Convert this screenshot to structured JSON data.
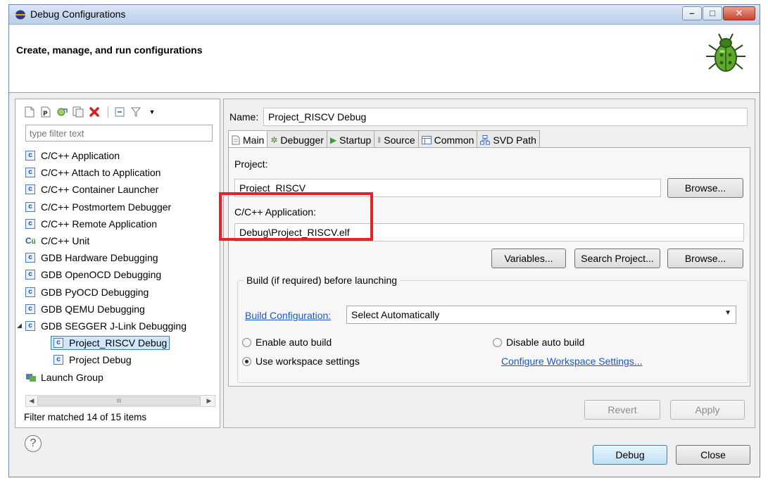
{
  "window": {
    "title": "Debug Configurations",
    "minimize": "–",
    "maximize": "□",
    "close": "✕"
  },
  "banner": {
    "title": "Create, manage, and run configurations"
  },
  "left": {
    "filter_placeholder": "type filter text",
    "tree": [
      {
        "label": "C/C++ Application",
        "icon": "c"
      },
      {
        "label": "C/C++ Attach to Application",
        "icon": "c"
      },
      {
        "label": "C/C++ Container Launcher",
        "icon": "c"
      },
      {
        "label": "C/C++ Postmortem Debugger",
        "icon": "c"
      },
      {
        "label": "C/C++ Remote Application",
        "icon": "c"
      },
      {
        "label": "C/C++ Unit",
        "icon": "cu"
      },
      {
        "label": "GDB Hardware Debugging",
        "icon": "c"
      },
      {
        "label": "GDB OpenOCD Debugging",
        "icon": "c"
      },
      {
        "label": "GDB PyOCD Debugging",
        "icon": "c"
      },
      {
        "label": "GDB QEMU Debugging",
        "icon": "c"
      },
      {
        "label": "GDB SEGGER J-Link Debugging",
        "icon": "c"
      },
      {
        "label": "Project_RISCV Debug",
        "icon": "c"
      },
      {
        "label": "Project Debug",
        "icon": "c"
      },
      {
        "label": "Launch Group",
        "icon": "launch-group"
      }
    ],
    "status": "Filter matched 14 of 15 items"
  },
  "right": {
    "name_label": "Name:",
    "name_value": "Project_RISCV Debug",
    "tabs": [
      {
        "label": "Main",
        "icon": "main-tab-icon"
      },
      {
        "label": "Debugger",
        "icon": "debugger-tab-icon"
      },
      {
        "label": "Startup",
        "icon": "startup-tab-icon"
      },
      {
        "label": "Source",
        "icon": "source-tab-icon"
      },
      {
        "label": "Common",
        "icon": "common-tab-icon"
      },
      {
        "label": "SVD Path",
        "icon": "svd-tab-icon"
      }
    ],
    "project_label": "Project:",
    "project_value": "Project_RISCV",
    "browse_label": "Browse...",
    "app_label": "C/C++ Application:",
    "app_value": "Debug\\Project_RISCV.elf",
    "variables_label": "Variables...",
    "search_project_label": "Search Project...",
    "browse2_label": "Browse...",
    "build_group_title": "Build (if required) before launching",
    "build_config_link": "Build Configuration:",
    "build_config_value": "Select Automatically",
    "enable_auto_build": "Enable auto build",
    "disable_auto_build": "Disable auto build",
    "use_workspace": "Use workspace settings",
    "configure_workspace_link": "Configure Workspace Settings...",
    "revert_label": "Revert",
    "apply_label": "Apply"
  },
  "footer": {
    "help": "?",
    "debug_label": "Debug",
    "close_label": "Close"
  },
  "colors": {
    "highlight": "#e8212a",
    "link": "#1a56c8",
    "selection": "#cfe6fb"
  }
}
